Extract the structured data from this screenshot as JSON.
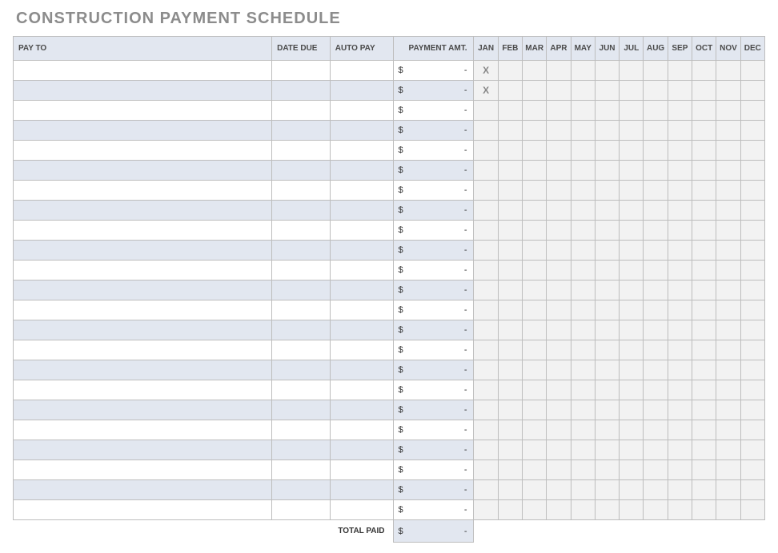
{
  "title": "CONSTRUCTION PAYMENT SCHEDULE",
  "currency": "$",
  "empty_amount": "-",
  "mark_glyph": "X",
  "headers": {
    "pay_to": "PAY TO",
    "date_due": "DATE DUE",
    "auto_pay": "AUTO PAY",
    "payment_amt": "PAYMENT AMT."
  },
  "months": [
    "JAN",
    "FEB",
    "MAR",
    "APR",
    "MAY",
    "JUN",
    "JUL",
    "AUG",
    "SEP",
    "OCT",
    "NOV",
    "DEC"
  ],
  "rows": [
    {
      "pay_to": "",
      "date_due": "",
      "auto_pay": "",
      "amount": "-",
      "marks": [
        "X",
        "",
        "",
        "",
        "",
        "",
        "",
        "",
        "",
        "",
        "",
        ""
      ]
    },
    {
      "pay_to": "",
      "date_due": "",
      "auto_pay": "",
      "amount": "-",
      "marks": [
        "X",
        "",
        "",
        "",
        "",
        "",
        "",
        "",
        "",
        "",
        "",
        ""
      ]
    },
    {
      "pay_to": "",
      "date_due": "",
      "auto_pay": "",
      "amount": "-",
      "marks": [
        "",
        "",
        "",
        "",
        "",
        "",
        "",
        "",
        "",
        "",
        "",
        ""
      ]
    },
    {
      "pay_to": "",
      "date_due": "",
      "auto_pay": "",
      "amount": "-",
      "marks": [
        "",
        "",
        "",
        "",
        "",
        "",
        "",
        "",
        "",
        "",
        "",
        ""
      ]
    },
    {
      "pay_to": "",
      "date_due": "",
      "auto_pay": "",
      "amount": "-",
      "marks": [
        "",
        "",
        "",
        "",
        "",
        "",
        "",
        "",
        "",
        "",
        "",
        ""
      ]
    },
    {
      "pay_to": "",
      "date_due": "",
      "auto_pay": "",
      "amount": "-",
      "marks": [
        "",
        "",
        "",
        "",
        "",
        "",
        "",
        "",
        "",
        "",
        "",
        ""
      ]
    },
    {
      "pay_to": "",
      "date_due": "",
      "auto_pay": "",
      "amount": "-",
      "marks": [
        "",
        "",
        "",
        "",
        "",
        "",
        "",
        "",
        "",
        "",
        "",
        ""
      ]
    },
    {
      "pay_to": "",
      "date_due": "",
      "auto_pay": "",
      "amount": "-",
      "marks": [
        "",
        "",
        "",
        "",
        "",
        "",
        "",
        "",
        "",
        "",
        "",
        ""
      ]
    },
    {
      "pay_to": "",
      "date_due": "",
      "auto_pay": "",
      "amount": "-",
      "marks": [
        "",
        "",
        "",
        "",
        "",
        "",
        "",
        "",
        "",
        "",
        "",
        ""
      ]
    },
    {
      "pay_to": "",
      "date_due": "",
      "auto_pay": "",
      "amount": "-",
      "marks": [
        "",
        "",
        "",
        "",
        "",
        "",
        "",
        "",
        "",
        "",
        "",
        ""
      ]
    },
    {
      "pay_to": "",
      "date_due": "",
      "auto_pay": "",
      "amount": "-",
      "marks": [
        "",
        "",
        "",
        "",
        "",
        "",
        "",
        "",
        "",
        "",
        "",
        ""
      ]
    },
    {
      "pay_to": "",
      "date_due": "",
      "auto_pay": "",
      "amount": "-",
      "marks": [
        "",
        "",
        "",
        "",
        "",
        "",
        "",
        "",
        "",
        "",
        "",
        ""
      ]
    },
    {
      "pay_to": "",
      "date_due": "",
      "auto_pay": "",
      "amount": "-",
      "marks": [
        "",
        "",
        "",
        "",
        "",
        "",
        "",
        "",
        "",
        "",
        "",
        ""
      ]
    },
    {
      "pay_to": "",
      "date_due": "",
      "auto_pay": "",
      "amount": "-",
      "marks": [
        "",
        "",
        "",
        "",
        "",
        "",
        "",
        "",
        "",
        "",
        "",
        ""
      ]
    },
    {
      "pay_to": "",
      "date_due": "",
      "auto_pay": "",
      "amount": "-",
      "marks": [
        "",
        "",
        "",
        "",
        "",
        "",
        "",
        "",
        "",
        "",
        "",
        ""
      ]
    },
    {
      "pay_to": "",
      "date_due": "",
      "auto_pay": "",
      "amount": "-",
      "marks": [
        "",
        "",
        "",
        "",
        "",
        "",
        "",
        "",
        "",
        "",
        "",
        ""
      ]
    },
    {
      "pay_to": "",
      "date_due": "",
      "auto_pay": "",
      "amount": "-",
      "marks": [
        "",
        "",
        "",
        "",
        "",
        "",
        "",
        "",
        "",
        "",
        "",
        ""
      ]
    },
    {
      "pay_to": "",
      "date_due": "",
      "auto_pay": "",
      "amount": "-",
      "marks": [
        "",
        "",
        "",
        "",
        "",
        "",
        "",
        "",
        "",
        "",
        "",
        ""
      ]
    },
    {
      "pay_to": "",
      "date_due": "",
      "auto_pay": "",
      "amount": "-",
      "marks": [
        "",
        "",
        "",
        "",
        "",
        "",
        "",
        "",
        "",
        "",
        "",
        ""
      ]
    },
    {
      "pay_to": "",
      "date_due": "",
      "auto_pay": "",
      "amount": "-",
      "marks": [
        "",
        "",
        "",
        "",
        "",
        "",
        "",
        "",
        "",
        "",
        "",
        ""
      ]
    },
    {
      "pay_to": "",
      "date_due": "",
      "auto_pay": "",
      "amount": "-",
      "marks": [
        "",
        "",
        "",
        "",
        "",
        "",
        "",
        "",
        "",
        "",
        "",
        ""
      ]
    },
    {
      "pay_to": "",
      "date_due": "",
      "auto_pay": "",
      "amount": "-",
      "marks": [
        "",
        "",
        "",
        "",
        "",
        "",
        "",
        "",
        "",
        "",
        "",
        ""
      ]
    },
    {
      "pay_to": "",
      "date_due": "",
      "auto_pay": "",
      "amount": "-",
      "marks": [
        "",
        "",
        "",
        "",
        "",
        "",
        "",
        "",
        "",
        "",
        "",
        ""
      ]
    }
  ],
  "totals": {
    "label": "TOTAL PAID",
    "amount": "-"
  }
}
